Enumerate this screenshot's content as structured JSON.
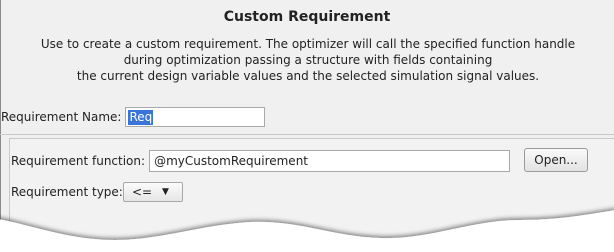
{
  "dialog": {
    "title": "Custom Requirement",
    "description_lines": [
      "Use to create a custom requirement. The optimizer will call the specified function handle",
      "during optimization passing a structure with fields containing",
      "the current design variable values and the selected simulation signal values."
    ]
  },
  "requirement_name": {
    "label": "Requirement Name:",
    "value": "Req"
  },
  "requirement_function": {
    "label": "Requirement function:",
    "value": "@myCustomRequirement",
    "open_label": "Open..."
  },
  "requirement_type": {
    "label": "Requirement type:",
    "selected": "<="
  },
  "icons": {
    "dropdown": "chevron-down-icon"
  }
}
